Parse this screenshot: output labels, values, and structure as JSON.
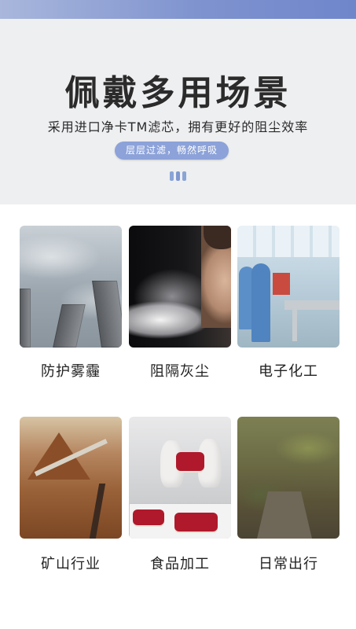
{
  "header": {
    "title": "佩戴多用场景",
    "subtitle": "采用进口净卡TM滤芯，拥有更好的阻尘效率",
    "pill_text": "层层过滤，畅然呼吸"
  },
  "scenes": [
    {
      "label": "防护雾霾",
      "image": "smoggy-city-skyline"
    },
    {
      "label": "阻隔灰尘",
      "image": "woman-blowing-dust"
    },
    {
      "label": "电子化工",
      "image": "cleanroom-lab-workers"
    },
    {
      "label": "矿山行业",
      "image": "mining-excavator"
    },
    {
      "label": "食品加工",
      "image": "food-processing-cakes"
    },
    {
      "label": "日常出行",
      "image": "mossy-outdoor-path"
    }
  ],
  "colors": {
    "accent": "#8ca2d9",
    "header_bg": "#eeeff1",
    "top_strip": "#7f93cf"
  }
}
